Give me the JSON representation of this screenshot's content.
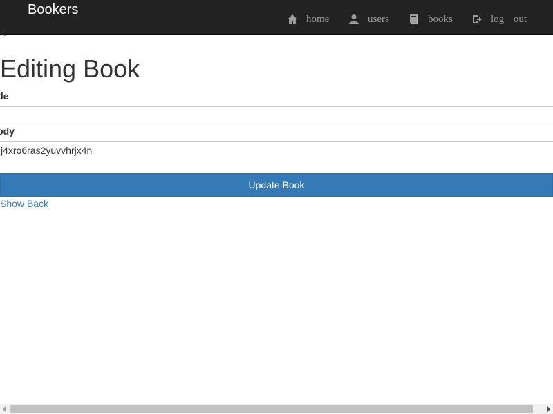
{
  "navbar": {
    "brand": "Bookers",
    "items": [
      {
        "label": "home",
        "icon": "home-icon"
      },
      {
        "label": "users",
        "icon": "user-icon"
      },
      {
        "label": "books",
        "icon": "book-icon"
      },
      {
        "label": "log out",
        "icon": "log-out-icon"
      }
    ]
  },
  "back_glyph": "<",
  "page": {
    "title": "Editing Book"
  },
  "form": {
    "title_label": "Title",
    "title_value": "",
    "body_label": "Body",
    "body_value": "j4xro6ras2yuvvhrjx4n",
    "submit_label": "Update Book"
  },
  "links": {
    "show": "Show",
    "back": "Back"
  },
  "colors": {
    "navbar_bg": "#222222",
    "nav_text": "#9d9d9d",
    "primary": "#337ab7"
  }
}
